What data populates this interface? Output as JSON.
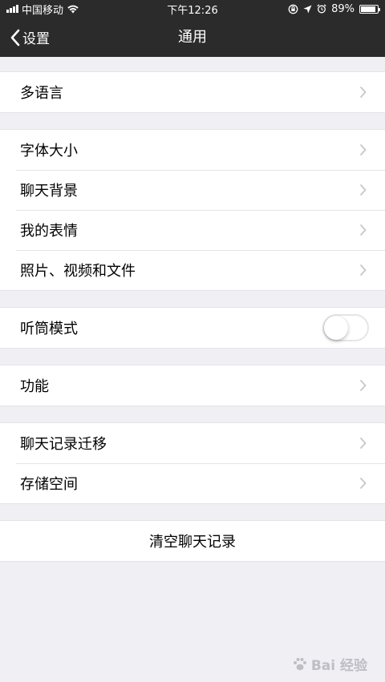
{
  "status": {
    "carrier": "中国移动",
    "time": "下午12:26",
    "battery": "89%",
    "battery_level": 0.89
  },
  "nav": {
    "back_label": "设置",
    "title": "通用"
  },
  "groups": [
    {
      "items": [
        {
          "label": "多语言"
        }
      ]
    },
    {
      "items": [
        {
          "label": "字体大小"
        },
        {
          "label": "聊天背景"
        },
        {
          "label": "我的表情"
        },
        {
          "label": "照片、视频和文件"
        }
      ]
    },
    {
      "items": [
        {
          "label": "听筒模式",
          "toggle": false
        }
      ]
    },
    {
      "items": [
        {
          "label": "功能"
        }
      ]
    },
    {
      "items": [
        {
          "label": "聊天记录迁移"
        },
        {
          "label": "存储空间"
        }
      ]
    },
    {
      "items": [
        {
          "label": "清空聊天记录"
        }
      ]
    }
  ],
  "watermark": "Bai 经验",
  "colors": {
    "nav_bg": "#2b2b2b",
    "page_bg": "#efeff4",
    "chevron": "#c7c7cc"
  }
}
